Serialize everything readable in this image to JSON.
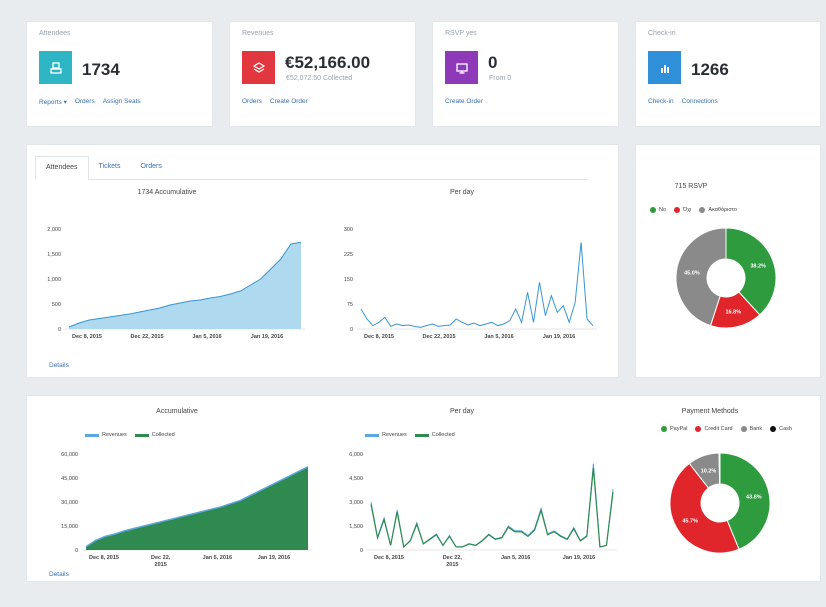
{
  "stats": [
    {
      "title": "Attendees",
      "value": "1734",
      "sub": "",
      "links": [
        "Reports ▾",
        "Orders",
        "Assign Seats"
      ],
      "color": "#2fb6c4",
      "icon": "attendee-icon"
    },
    {
      "title": "Revenues",
      "value": "€52,166.00",
      "sub": "€52,072.50 Collected",
      "links": [
        "Orders",
        "Create Order"
      ],
      "color": "#e2373f",
      "icon": "layers-icon"
    },
    {
      "title": "RSVP yes",
      "value": "0",
      "sub": "From 0",
      "links": [
        "Create Order"
      ],
      "color": "#8e3ab8",
      "icon": "monitor-icon"
    },
    {
      "title": "Check-in",
      "value": "1266",
      "sub": "",
      "links": [
        "Check-in",
        "Connections"
      ],
      "color": "#2f8fd8",
      "icon": "bar-chart-icon"
    }
  ],
  "tabs": [
    "Attendees",
    "Tickets",
    "Orders"
  ],
  "details_label": "Details",
  "chart_data": [
    {
      "type": "area",
      "title": "1734 Accumulative",
      "xlabels": [
        "Dec 8, 2015",
        "Dec 22, 2015",
        "Jan 5, 2016",
        "Jan 19, 2016"
      ],
      "yticks": [
        "0",
        "500",
        "1,000",
        "1,500",
        "2,000"
      ],
      "ylim": [
        0,
        2000
      ],
      "color": "#aed9ef",
      "line_color": "#3a95cf",
      "values": [
        40,
        120,
        180,
        210,
        240,
        270,
        300,
        340,
        380,
        420,
        480,
        520,
        560,
        580,
        620,
        650,
        700,
        760,
        880,
        1000,
        1200,
        1400,
        1700,
        1734
      ]
    },
    {
      "type": "line",
      "title": "Per day",
      "xlabels": [
        "Dec 8, 2015",
        "Dec 22, 2015",
        "Jan 5, 2016",
        "Jan 19, 2016"
      ],
      "yticks": [
        "0",
        "75",
        "150",
        "225",
        "300"
      ],
      "ylim": [
        0,
        300
      ],
      "color": "#3a95cf",
      "values": [
        60,
        30,
        10,
        20,
        35,
        8,
        15,
        10,
        12,
        8,
        5,
        10,
        15,
        8,
        10,
        12,
        30,
        20,
        12,
        18,
        10,
        15,
        20,
        10,
        15,
        25,
        60,
        20,
        110,
        20,
        140,
        40,
        100,
        50,
        70,
        20,
        80,
        260,
        30,
        10
      ]
    },
    {
      "type": "pie",
      "title": "715 RSVP",
      "labels": [
        "No",
        "Όχι",
        "Ακαθόριστο"
      ],
      "values": [
        38.2,
        16.8,
        45.0
      ],
      "display": [
        "38.2%",
        "16.8%",
        "45.0%"
      ],
      "colors": [
        "#2e9b3e",
        "#e0252b",
        "#8a8a8a"
      ]
    },
    {
      "type": "area",
      "title": "Accumulative",
      "series_names": [
        "Revenues",
        "Collected"
      ],
      "colors": [
        "#5ba7e0",
        "#2e8a4e"
      ],
      "xlabels": [
        "Dec 8, 2015",
        "Dec 22,\n2015",
        "Jan 5, 2016",
        "Jan 19, 2016"
      ],
      "yticks": [
        "0",
        "15,000",
        "30,000",
        "45,000",
        "60,000"
      ],
      "ylim": [
        0,
        60000
      ],
      "values": [
        2000,
        6000,
        8500,
        10000,
        12000,
        13500,
        15000,
        16500,
        18000,
        19500,
        21000,
        22500,
        24000,
        25500,
        27000,
        29000,
        31000,
        34000,
        37000,
        40000,
        43000,
        46000,
        49000,
        52000
      ]
    },
    {
      "type": "line",
      "title": "Per day",
      "series_names": [
        "Revenues",
        "Collected"
      ],
      "colors": [
        "#5ba7e0",
        "#2e8a4e"
      ],
      "xlabels": [
        "Dec 8, 2015",
        "Dec 22,\n2015",
        "Jan 5, 2016",
        "Jan 19, 2016"
      ],
      "yticks": [
        "0",
        "1,500",
        "3,000",
        "4,500",
        "6,000"
      ],
      "ylim": [
        0,
        6000
      ],
      "values": [
        3000,
        800,
        2000,
        300,
        2500,
        200,
        600,
        1700,
        400,
        700,
        1000,
        300,
        900,
        200,
        200,
        400,
        300,
        600,
        1000,
        700,
        800,
        1500,
        1200,
        1200,
        900,
        1300,
        2600,
        1000,
        1200,
        900,
        700,
        1400,
        600,
        900,
        5400,
        200,
        300,
        3800
      ]
    },
    {
      "type": "pie",
      "title": "Payment Methods",
      "labels": [
        "PayPal",
        "Credit Card",
        "Bank",
        "Cash"
      ],
      "values": [
        43.8,
        45.7,
        10.2,
        0.3
      ],
      "display": [
        "43.8%",
        "45.7%",
        "10.2%",
        ""
      ],
      "colors": [
        "#2e9b3e",
        "#e0252b",
        "#8a8a8a",
        "#111111"
      ]
    }
  ]
}
